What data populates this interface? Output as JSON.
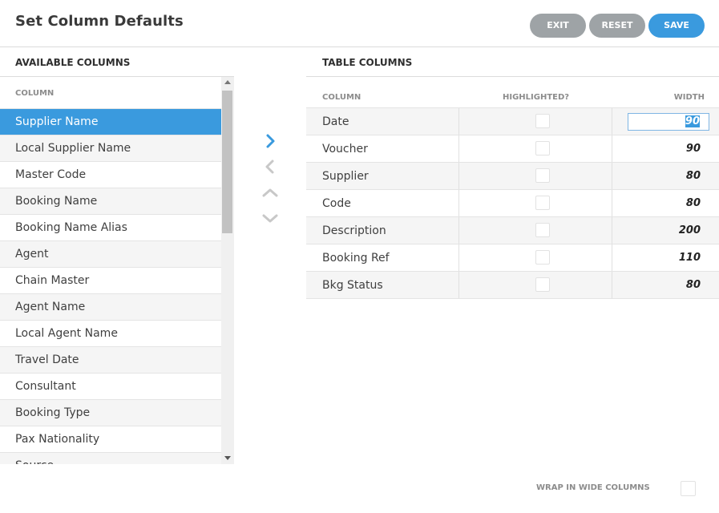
{
  "header": {
    "title": "Set Column Defaults",
    "exit_label": "EXIT",
    "reset_label": "RESET",
    "save_label": "SAVE"
  },
  "available": {
    "title": "AVAILABLE COLUMNS",
    "column_header": "COLUMN",
    "selected_index": 0,
    "items": [
      "Supplier Name",
      "Local Supplier Name",
      "Master Code",
      "Booking Name",
      "Booking Name Alias",
      "Agent",
      "Chain Master",
      "Agent Name",
      "Local Agent Name",
      "Travel Date",
      "Consultant",
      "Booking Type",
      "Pax Nationality",
      "Source"
    ]
  },
  "controls": {
    "move_right_icon": "chevron-right-icon",
    "move_left_icon": "chevron-left-icon",
    "move_up_icon": "chevron-up-icon",
    "move_down_icon": "chevron-down-icon"
  },
  "table": {
    "title": "TABLE COLUMNS",
    "headers": {
      "column": "COLUMN",
      "highlighted": "HIGHLIGHTED?",
      "width": "WIDTH"
    },
    "rows": [
      {
        "name": "Date",
        "highlighted": false,
        "width": "90",
        "editing": true
      },
      {
        "name": "Voucher",
        "highlighted": false,
        "width": "90"
      },
      {
        "name": "Supplier",
        "highlighted": false,
        "width": "80"
      },
      {
        "name": "Code",
        "highlighted": false,
        "width": "80"
      },
      {
        "name": "Description",
        "highlighted": false,
        "width": "200"
      },
      {
        "name": "Booking Ref",
        "highlighted": false,
        "width": "110"
      },
      {
        "name": "Bkg Status",
        "highlighted": false,
        "width": "80"
      }
    ]
  },
  "footer": {
    "wrap_label": "WRAP IN WIDE COLUMNS",
    "wrap_checked": false
  },
  "colors": {
    "accent": "#3a9ade",
    "neutral_button": "#9ea3a6",
    "inactive_arrow": "#c8c8c8"
  }
}
